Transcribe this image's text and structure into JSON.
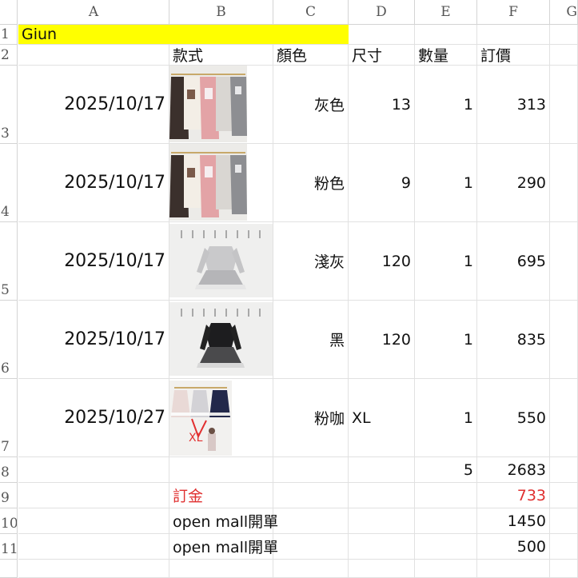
{
  "columns": [
    "A",
    "B",
    "C",
    "D",
    "E",
    "F",
    "G"
  ],
  "row_numbers": [
    "1",
    "2",
    "3",
    "4",
    "5",
    "6",
    "7",
    "8",
    "9",
    "10",
    "11"
  ],
  "title": "Giun",
  "headers": {
    "style": "款式",
    "color": "顏色",
    "size": "尺寸",
    "qty": "數量",
    "price": "訂價"
  },
  "orders": [
    {
      "date": "2025/10/17",
      "color": "灰色",
      "size": "13",
      "qty": "1",
      "price": "313",
      "photo": "hanging-cardigans-photo"
    },
    {
      "date": "2025/10/17",
      "color": "粉色",
      "size": "9",
      "qty": "1",
      "price": "290",
      "photo": "hanging-cardigans-photo"
    },
    {
      "date": "2025/10/17",
      "color": "淺灰",
      "size": "120",
      "qty": "1",
      "price": "695",
      "photo": "grey-dress-photo"
    },
    {
      "date": "2025/10/17",
      "color": "黑",
      "size": "120",
      "qty": "1",
      "price": "835",
      "photo": "black-dress-photo"
    },
    {
      "date": "2025/10/27",
      "color": "粉咖",
      "size": "XL",
      "qty": "1",
      "price": "550",
      "photo": "three-dresses-photo"
    }
  ],
  "totals": {
    "qty": "5",
    "price": "2683"
  },
  "deposit": {
    "label": "訂金",
    "value": "733"
  },
  "extras": [
    {
      "label": "open mall開單",
      "value": "1450"
    },
    {
      "label": "open mall開單",
      "value": "500"
    }
  ],
  "photo_annotation": "XL",
  "colors": {
    "title_fill": "#ffff00",
    "deposit_text": "#e03030",
    "gridline": "#e1e1e1"
  }
}
